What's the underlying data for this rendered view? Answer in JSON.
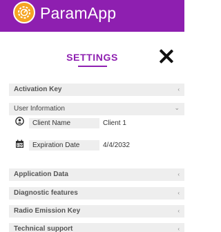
{
  "header": {
    "app_title": "ParamApp",
    "logo_icon": "gear-dial-logo-icon",
    "bar_color": "#8e1fb0"
  },
  "settings": {
    "title": "SETTINGS",
    "close_icon": "close-icon"
  },
  "sections": {
    "activation_key": {
      "label": "Activation Key",
      "chevron": "‹",
      "expanded": false
    },
    "user_information": {
      "label": "User Information",
      "chevron": "⌄",
      "expanded": true,
      "fields": {
        "client_name": {
          "label": "Client Name",
          "value": "Client 1",
          "icon": "user-icon"
        },
        "expiration_date": {
          "label": "Expiration Date",
          "value": "4/4/2032",
          "icon": "calendar-icon"
        }
      }
    },
    "application_data": {
      "label": "Application Data",
      "chevron": "‹",
      "expanded": false
    },
    "diagnostic_features": {
      "label": "Diagnostic features",
      "chevron": "‹",
      "expanded": false
    },
    "radio_emission_key": {
      "label": "Radio Emission Key",
      "chevron": "‹",
      "expanded": false
    },
    "technical_support": {
      "label": "Technical support",
      "chevron": "‹",
      "expanded": false
    }
  }
}
